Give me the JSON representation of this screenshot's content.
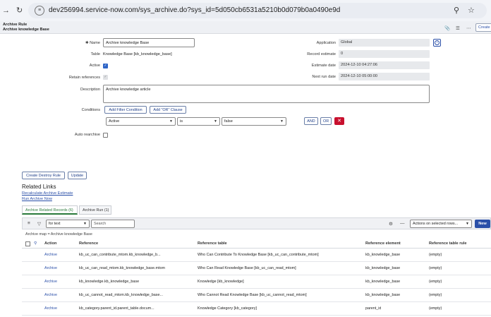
{
  "browser": {
    "url": "dev256994.service-now.com/sys_archive.do?sys_id=5d050cb6531a5210b0d079b0a0490e9d"
  },
  "header": {
    "line1": "Archive Rule",
    "line2": "Archive knowledge Base",
    "create_label": "Create"
  },
  "form": {
    "name_label": "Name",
    "name_value": "Archive knowledge Base",
    "table_label": "Table",
    "table_value": "Knowledge Base [kb_knowledge_base]",
    "active_label": "Active",
    "retain_label": "Retain references",
    "description_label": "Description",
    "description_value": "Archive knowledge article",
    "conditions_label": "Conditions",
    "add_filter_label": "Add Filter Condition",
    "add_or_label": "Add \"OR\" Clause",
    "cond_field": "Active",
    "cond_operator": "is",
    "cond_value": "false",
    "and_label": "AND",
    "or_label": "OR",
    "auto_rearchive_label": "Auto rearchive",
    "application_label": "Application",
    "application_value": "Global",
    "record_estimate_label": "Record estimate",
    "record_estimate_value": "0",
    "estimate_date_label": "Estimate date",
    "estimate_date_value": "2024-12-10 04:27:06",
    "next_run_label": "Next run date",
    "next_run_value": "2024-12-10 05:00:00"
  },
  "actions": {
    "create_destroy": "Create Destroy Rule",
    "update": "Update"
  },
  "related": {
    "title": "Related Links",
    "links": [
      "Recalculate Archive Estimate",
      "Run Archive Now"
    ],
    "tabs": [
      "Archive Related Records (6)",
      "Archive Run (1)"
    ]
  },
  "list": {
    "filter_select": "for text",
    "search_placeholder": "Search",
    "actions_select": "Actions on selected rows...",
    "new_label": "New",
    "breadcrumb": "Archive map = Archive knowledge Base",
    "columns": [
      "Action",
      "Reference",
      "Reference table",
      "Reference element",
      "Reference table rule"
    ],
    "rows": [
      [
        "Archive",
        "kb_uc_can_contribute_mtom.kb_knowledge_b...",
        "Who Can Contribute To Knowledge Base [kb_uc_can_contribute_mtom]",
        "kb_knowledge_base",
        "(empty)"
      ],
      [
        "Archive",
        "kb_uc_can_read_mtom.kb_knowledge_base.mtom",
        "Who Can Read Knowledge Base [kb_uc_can_read_mtom]",
        "kb_knowledge_base",
        "(empty)"
      ],
      [
        "Archive",
        "kb_knowledge.kb_knowledge_base",
        "Knowledge [kb_knowledge]",
        "kb_knowledge_base",
        "(empty)"
      ],
      [
        "Archive",
        "kb_uc_cannot_read_mtom.kb_knowledge_base...",
        "Who Cannot Read Knowledge Base [kb_uc_cannot_read_mtom]",
        "kb_knowledge_base",
        "(empty)"
      ],
      [
        "Archive",
        "kb_category.parent_id.parent_table.docum...",
        "Knowledge Category [kb_category]",
        "parent_id",
        "(empty)"
      ]
    ]
  },
  "icons": {
    "back": "arrow-left-icon",
    "reload": "reload-icon",
    "site_info": "site-info-icon",
    "zoom": "zoom-icon",
    "bookmark": "star-icon",
    "attach": "paperclip-icon",
    "settings": "sliders-icon",
    "more": "ellipsis-icon",
    "info": "info-icon",
    "hamburger": "hamburger-icon",
    "filter": "funnel-icon",
    "gear": "gear-icon",
    "collapse": "minus-icon",
    "search": "search-icon"
  },
  "colors": {
    "primary": "#2a4fa8",
    "active_tab": "#2a7a3a",
    "delete": "#c8102e"
  }
}
